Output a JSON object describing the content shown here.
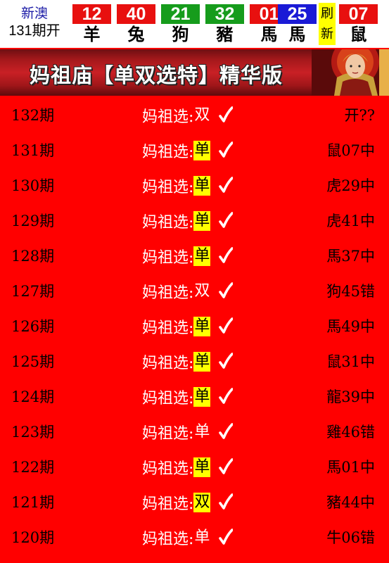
{
  "header": {
    "region": "新澳",
    "issue": "131期开",
    "balls": [
      {
        "num": "12",
        "zodiac": "羊",
        "color": "#e8100f"
      },
      {
        "num": "40",
        "zodiac": "兔",
        "color": "#e8100f"
      },
      {
        "num": "21",
        "zodiac": "狗",
        "color": "#169c1c"
      },
      {
        "num": "32",
        "zodiac": "豬",
        "color": "#169c1c"
      },
      {
        "num": "01",
        "zodiac": "馬",
        "color": "#e8100f"
      },
      {
        "num": "25",
        "zodiac": "馬",
        "color": "#1a1ad6"
      },
      {
        "num": "07",
        "zodiac": "鼠",
        "color": "#e8100f"
      }
    ],
    "refresh": [
      "刷",
      "新"
    ]
  },
  "banner": {
    "title": "妈祖庙【单双选特】精华版"
  },
  "pick_label": "妈祖选:",
  "rows": [
    {
      "period": "132期",
      "pick": "双",
      "highlight": false,
      "result": "开??"
    },
    {
      "period": "131期",
      "pick": "单",
      "highlight": true,
      "result": "鼠07中"
    },
    {
      "period": "130期",
      "pick": "单",
      "highlight": true,
      "result": "虎29中"
    },
    {
      "period": "129期",
      "pick": "单",
      "highlight": true,
      "result": "虎41中"
    },
    {
      "period": "128期",
      "pick": "单",
      "highlight": true,
      "result": "馬37中"
    },
    {
      "period": "127期",
      "pick": "双",
      "highlight": false,
      "result": "狗45错"
    },
    {
      "period": "126期",
      "pick": "单",
      "highlight": true,
      "result": "馬49中"
    },
    {
      "period": "125期",
      "pick": "单",
      "highlight": true,
      "result": "鼠31中"
    },
    {
      "period": "124期",
      "pick": "单",
      "highlight": true,
      "result": "龍39中"
    },
    {
      "period": "123期",
      "pick": "单",
      "highlight": false,
      "result": "雞46错"
    },
    {
      "period": "122期",
      "pick": "单",
      "highlight": true,
      "result": "馬01中"
    },
    {
      "period": "121期",
      "pick": "双",
      "highlight": true,
      "result": "豬44中"
    },
    {
      "period": "120期",
      "pick": "单",
      "highlight": false,
      "result": "牛06错"
    }
  ]
}
